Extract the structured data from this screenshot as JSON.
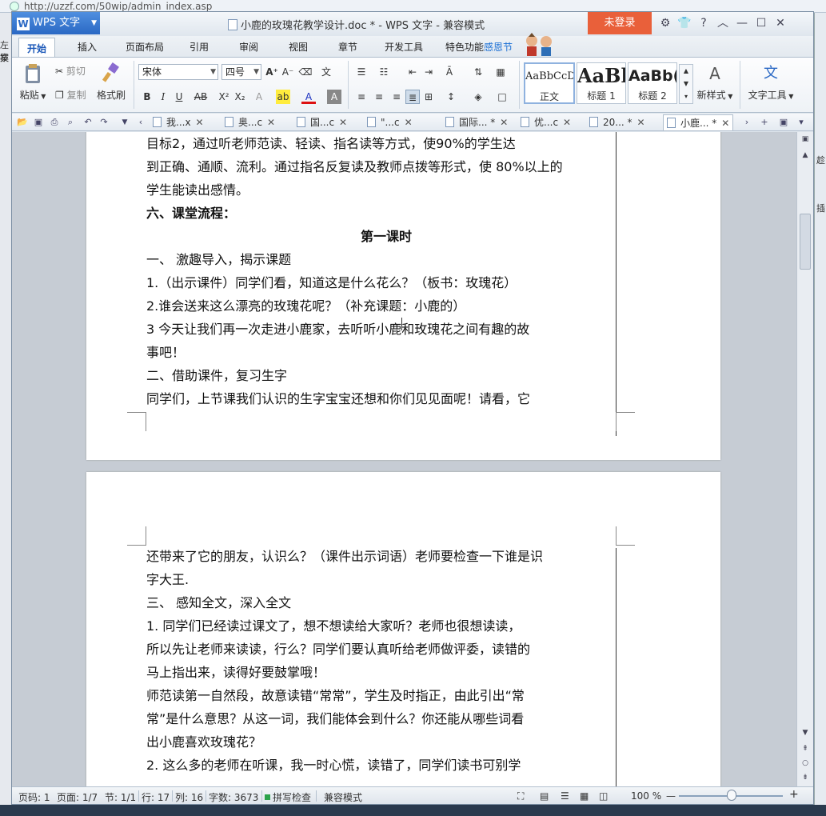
{
  "background": {
    "url": "http://uzzf.com/50wip/admin_index.asp",
    "left_fragments": [
      "左技",
      "案"
    ],
    "right_fragments": [
      "趁",
      "插"
    ]
  },
  "window": {
    "app_name": "WPS 文字",
    "doc_title": "小鹿的玫瑰花教学设计.doc * - WPS 文字 - 兼容模式",
    "login_label": "未登录",
    "controls": [
      "⚙",
      "👕",
      "?",
      "︿",
      "—",
      "☐",
      "✕"
    ]
  },
  "ribbon_tabs": [
    "开始",
    "插入",
    "页面布局",
    "引用",
    "审阅",
    "视图",
    "章节",
    "开发工具",
    "特色功能",
    "感恩节"
  ],
  "ribbon": {
    "paste": "粘贴",
    "cut": "剪切",
    "copy": "复制",
    "format_painter": "格式刷",
    "font_name": "宋体",
    "font_size": "四号",
    "new_style": "新样式",
    "text_tools": "文字工具",
    "styles": [
      {
        "preview": "AaBbCcD",
        "name": "正文"
      },
      {
        "preview": "AaBl",
        "name": "标题 1"
      },
      {
        "preview": "AaBb(",
        "name": "标题 2"
      }
    ]
  },
  "doc_tabs": [
    "我...x",
    "奥...c",
    "国...c",
    "\"...c",
    "国际... *",
    "优...c",
    "20... *",
    "小鹿... *"
  ],
  "page1_lines": [
    {
      "text": "目标2，通过听老师范读、轻读、指名读等方式，使90%的学生达",
      "cls": ""
    },
    {
      "text": "到正确、通顺、流利。通过指名反复读及教师点拨等形式，使 80%以上的",
      "cls": ""
    },
    {
      "text": "学生能读出感情。",
      "cls": ""
    },
    {
      "text": "六、课堂流程：",
      "cls": "bold"
    },
    {
      "text": "第一课时",
      "cls": "bold center"
    },
    {
      "text": "一、   激趣导入，揭示课题",
      "cls": ""
    },
    {
      "text": "   1.（出示课件）同学们看，知道这是什么花么？（板书：玫瑰花）",
      "cls": ""
    },
    {
      "text": "   2.谁会送来这么漂亮的玫瑰花呢？（补充课题：小鹿的）",
      "cls": ""
    },
    {
      "text": "   3  今天让我们再一次走进小鹿家，去听听小鹿和玫瑰花之间有趣的故",
      "cls": ""
    },
    {
      "text": "事吧！",
      "cls": ""
    },
    {
      "text": "二、借助课件，复习生字",
      "cls": ""
    },
    {
      "text": "    同学们，上节课我们认识的生字宝宝还想和你们见见面呢！请看，它",
      "cls": ""
    }
  ],
  "page2_lines": [
    {
      "text": "还带来了它的朋友，认识么？（课件出示词语）老师要检查一下谁是识",
      "cls": ""
    },
    {
      "text": "字大王.",
      "cls": ""
    },
    {
      "text": "三、   感知全文，深入全文",
      "cls": ""
    },
    {
      "text": "    1.   同学们已经读过课文了，想不想读给大家听？老师也很想读读，",
      "cls": ""
    },
    {
      "text": "    所以先让老师来读读，行么？同学们要认真听给老师做评委，读错的",
      "cls": ""
    },
    {
      "text": "    马上指出来，读得好要鼓掌哦！",
      "cls": ""
    },
    {
      "text": "    师范读第一自然段，故意读错“常常”，学生及时指正，由此引出“常",
      "cls": ""
    },
    {
      "text": "    常”是什么意思？从这一词，我们能体会到什么？你还能从哪些词看",
      "cls": ""
    },
    {
      "text": "    出小鹿喜欢玫瑰花？",
      "cls": ""
    },
    {
      "text": "   2.  这么多的老师在听课，我一时心慌，读错了，同学们读书可别学",
      "cls": ""
    }
  ],
  "status": {
    "page": "页码: 1",
    "pages": "页面: 1/7",
    "section": "节: 1/1",
    "row": "行: 17",
    "col": "列: 16",
    "words": "字数: 3673",
    "spell": "拼写检查",
    "compat": "兼容模式",
    "zoom": "100 %"
  }
}
